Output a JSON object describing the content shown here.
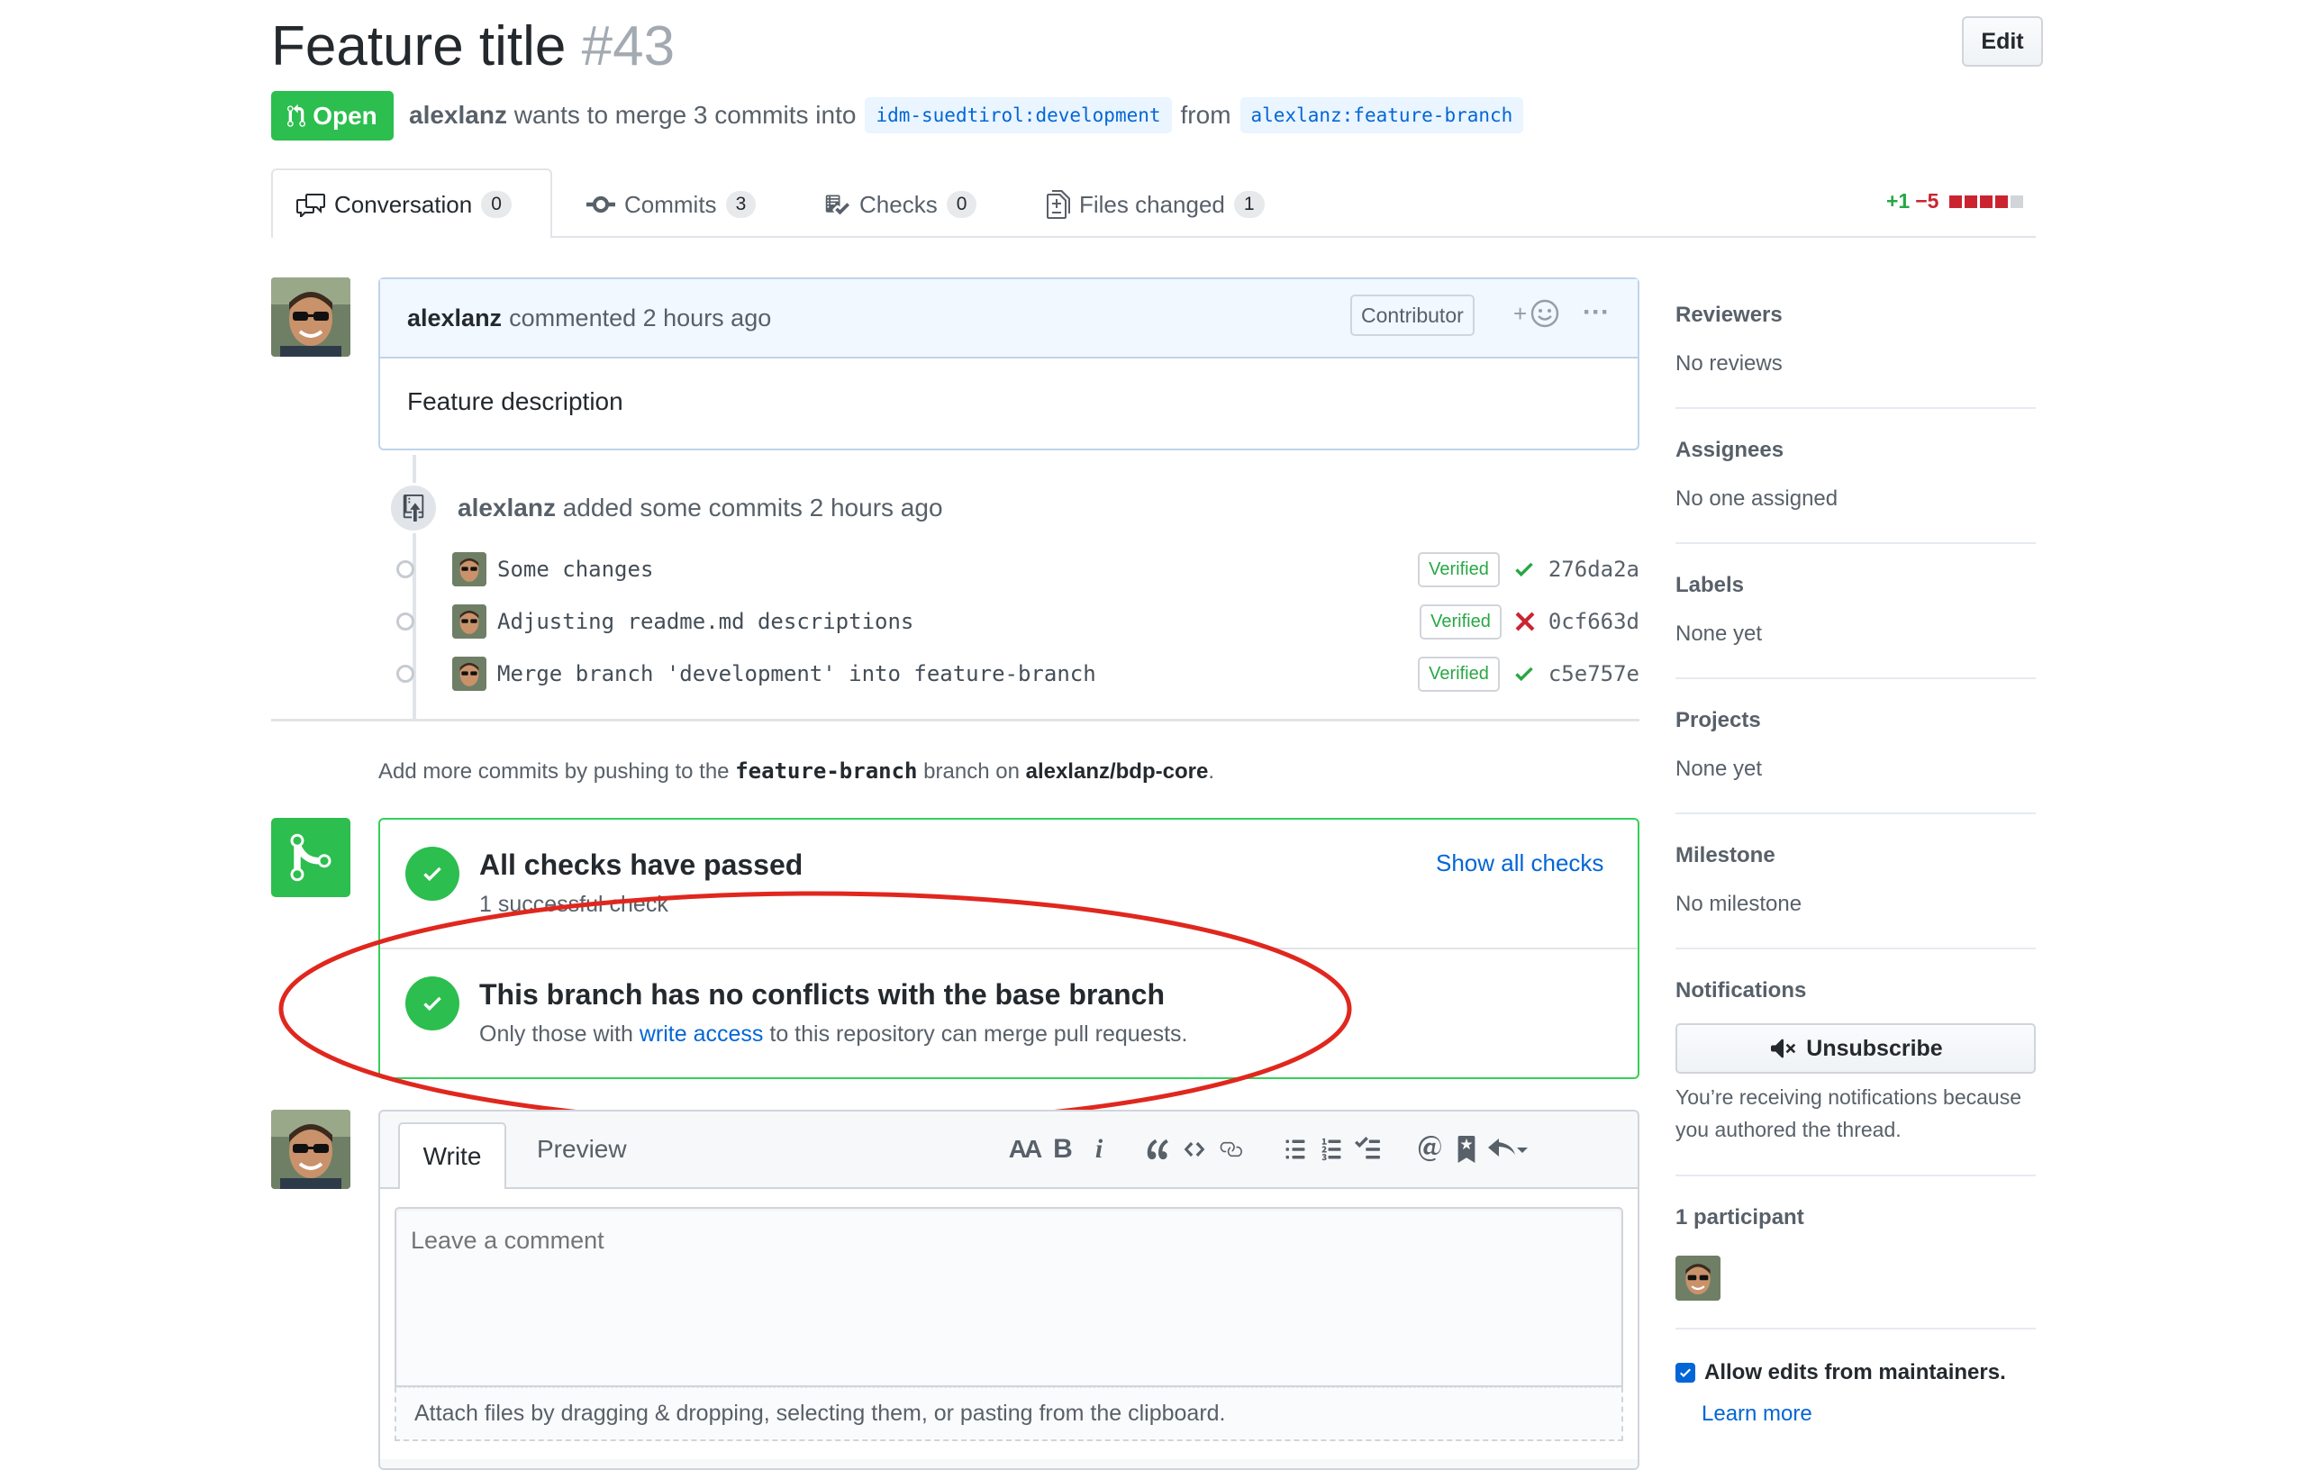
{
  "header": {
    "title": "Feature title",
    "number": "#43",
    "edit_label": "Edit",
    "state": "Open",
    "author": "alexlanz",
    "merge_text": "wants to merge 3 commits into",
    "base_branch": "idm-suedtirol:development",
    "from_text": "from",
    "head_branch": "alexlanz:feature-branch"
  },
  "tabs": [
    {
      "label": "Conversation",
      "count": "0"
    },
    {
      "label": "Commits",
      "count": "3"
    },
    {
      "label": "Checks",
      "count": "0"
    },
    {
      "label": "Files changed",
      "count": "1"
    }
  ],
  "diffstat": {
    "additions": "+1",
    "deletions": "−5"
  },
  "comment": {
    "author": "alexlanz",
    "action": "commented 2 hours ago",
    "badge": "Contributor",
    "reaction_plus": "+",
    "more": "···",
    "body": "Feature description"
  },
  "timeline": {
    "author": "alexlanz",
    "event": "added some commits 2 hours ago",
    "commits": [
      {
        "message": "Some changes",
        "verified": "Verified",
        "status": "success",
        "sha": "276da2a"
      },
      {
        "message": "Adjusting readme.md descriptions",
        "verified": "Verified",
        "status": "failure",
        "sha": "0cf663d"
      },
      {
        "message": "Merge branch 'development' into feature-branch",
        "verified": "Verified",
        "status": "success",
        "sha": "c5e757e"
      }
    ],
    "hint_prefix": "Add more commits by pushing to the",
    "hint_branch": "feature-branch",
    "hint_mid": "branch on",
    "hint_repo": "alexlanz/bdp-core",
    "hint_end": "."
  },
  "merge": {
    "checks_title": "All checks have passed",
    "checks_sub": "1 successful check",
    "show_all": "Show all checks",
    "conflict_title": "This branch has no conflicts with the base branch",
    "conflict_sub_prefix": "Only those with",
    "conflict_link": "write access",
    "conflict_sub_suffix": "to this repository can merge pull requests."
  },
  "editor": {
    "write_tab": "Write",
    "preview_tab": "Preview",
    "placeholder": "Leave a comment",
    "attach_text": "Attach files by dragging & dropping, selecting them, or pasting from the clipboard.",
    "toolbar": {
      "heading": "AA",
      "bold": "B",
      "italic": "i"
    }
  },
  "sidebar": {
    "reviewers": {
      "label": "Reviewers",
      "value": "No reviews"
    },
    "assignees": {
      "label": "Assignees",
      "value": "No one assigned"
    },
    "labels": {
      "label": "Labels",
      "value": "None yet"
    },
    "projects": {
      "label": "Projects",
      "value": "None yet"
    },
    "milestone": {
      "label": "Milestone",
      "value": "No milestone"
    },
    "notifications": {
      "label": "Notifications",
      "button": "Unsubscribe",
      "note": "You’re receiving notifications because you authored the thread."
    },
    "participants": {
      "label": "1 participant"
    },
    "allow_edits": "Allow edits from maintainers.",
    "learn_more": "Learn more"
  },
  "colors": {
    "success": "#2cbe4e",
    "danger": "#cb2431",
    "link": "#0366d6",
    "annotation": "#e0271e"
  }
}
